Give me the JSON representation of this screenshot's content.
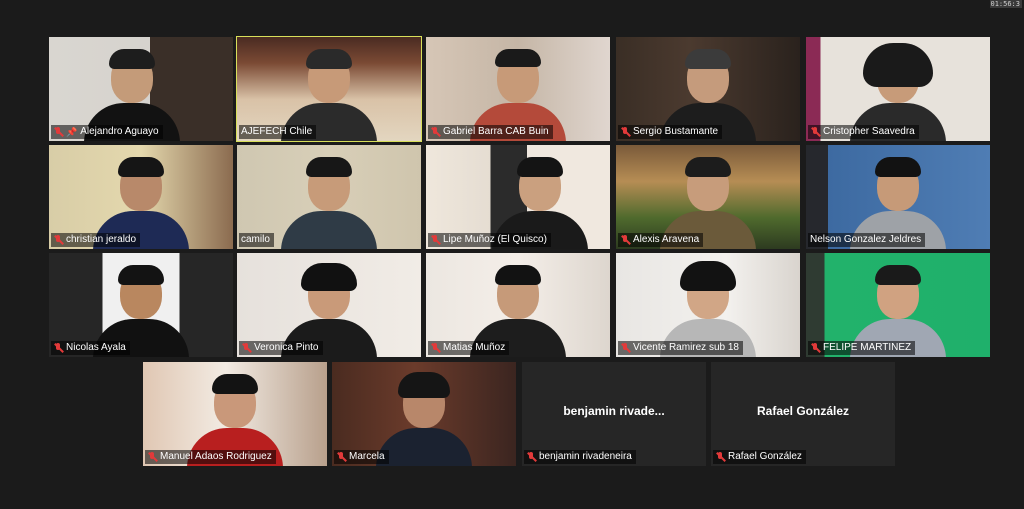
{
  "meeting": {
    "timer": "01:56:3"
  },
  "participants": [
    {
      "id": "p1",
      "name": "Alejandro Aguayo",
      "muted": true,
      "pinned": true
    },
    {
      "id": "p2",
      "name": "AJEFECH Chile",
      "muted": false,
      "active": true
    },
    {
      "id": "p3",
      "name": "Gabriel Barra CAB Buin",
      "muted": true
    },
    {
      "id": "p4",
      "name": "Sergio Bustamante",
      "muted": true
    },
    {
      "id": "p5",
      "name": "Cristopher Saavedra",
      "muted": true
    },
    {
      "id": "p6",
      "name": "christian jeraldo",
      "muted": true
    },
    {
      "id": "p7",
      "name": "camilo",
      "muted": false
    },
    {
      "id": "p8",
      "name": "Lipe Muñoz (El Quisco)",
      "muted": true
    },
    {
      "id": "p9",
      "name": "Alexis Aravena",
      "muted": true
    },
    {
      "id": "p10",
      "name": "Nelson Gonzalez Jeldres",
      "muted": false
    },
    {
      "id": "p11",
      "name": "Nicolas Ayala",
      "muted": true
    },
    {
      "id": "p12",
      "name": "Veronica Pinto",
      "muted": true
    },
    {
      "id": "p13",
      "name": "Matias Muñoz",
      "muted": true
    },
    {
      "id": "p14",
      "name": "Vicente Ramirez sub 18",
      "muted": true
    },
    {
      "id": "p15",
      "name": "FELIPE MARTINEZ",
      "muted": true
    },
    {
      "id": "p16",
      "name": "Manuel Adaos Rodriguez",
      "muted": true
    },
    {
      "id": "p17",
      "name": "Marcela",
      "muted": true
    },
    {
      "id": "p18",
      "name": "benjamin rivadeneira",
      "muted": true,
      "center_label": "benjamin rivade..."
    },
    {
      "id": "p19",
      "name": "Rafael González",
      "muted": true,
      "center_label": "Rafael González"
    }
  ]
}
